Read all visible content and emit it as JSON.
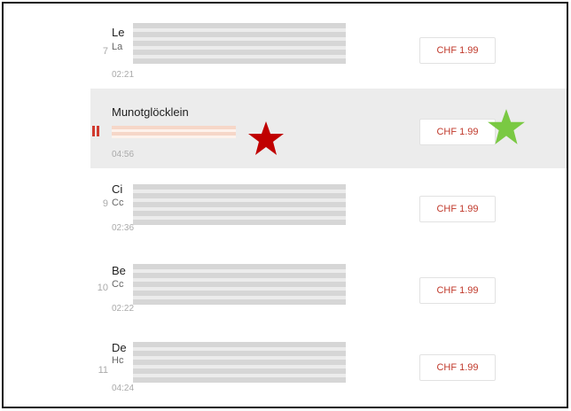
{
  "tracks": [
    {
      "number": "7",
      "title": "Le",
      "artist": "La",
      "duration": "02:21",
      "price": "CHF 1.99"
    },
    {
      "number": "",
      "title": "Munotglöcklein",
      "artist": "",
      "duration": "04:56",
      "price": "CHF 1.99"
    },
    {
      "number": "9",
      "title": "Ci",
      "artist": "Cc",
      "duration": "02:36",
      "price": "CHF 1.99"
    },
    {
      "number": "10",
      "title": "Be",
      "artist": "Cc",
      "duration": "02:22",
      "price": "CHF 1.99"
    },
    {
      "number": "11",
      "title": "De",
      "artist": "Hc",
      "duration": "04:24",
      "price": "CHF 1.99"
    }
  ],
  "colors": {
    "accent": "#c0392b",
    "playing_row": "#ececec",
    "star_red": "#c00000",
    "star_green": "#7ac943"
  }
}
